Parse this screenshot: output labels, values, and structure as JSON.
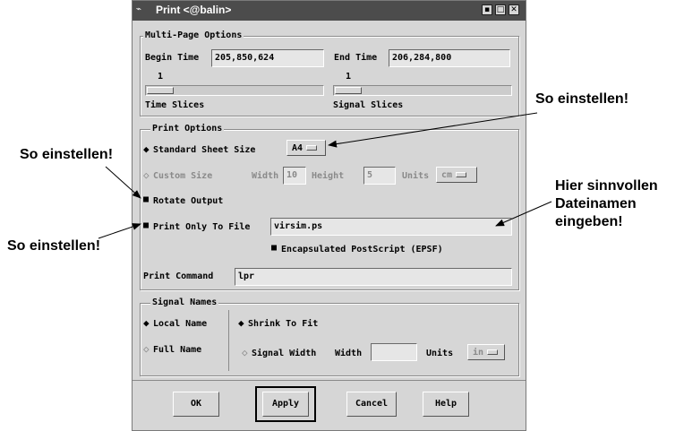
{
  "window": {
    "title": "Print <@balin>"
  },
  "multi_page": {
    "legend": "Multi-Page Options",
    "begin_time_label": "Begin Time",
    "begin_time_value": "205,850,624",
    "end_time_label": "End Time",
    "end_time_value": "206,284,800",
    "time_slices_count": "1",
    "signal_slices_count": "1",
    "time_slices_label": "Time Slices",
    "signal_slices_label": "Signal Slices"
  },
  "print_options": {
    "legend": "Print Options",
    "standard_sheet_label": "Standard Sheet Size",
    "sheet_size": "A4",
    "custom_size_label": "Custom Size",
    "width_label": "Width",
    "width_value": "10",
    "height_label": "Height",
    "height_value": "5",
    "units_label": "Units",
    "units_value": "cm",
    "rotate_label": "Rotate Output",
    "print_to_file_label": "Print Only To File",
    "file_value": "virsim.ps",
    "epsf_label": "Encapsulated PostScript (EPSF)"
  },
  "print_command": {
    "label": "Print Command",
    "value": "lpr"
  },
  "signal_names": {
    "legend": "Signal Names",
    "local_name": "Local Name",
    "full_name": "Full Name",
    "shrink_to_fit": "Shrink To Fit",
    "signal_width": "Signal Width",
    "width_label": "Width",
    "units_label": "Units",
    "units_value": "in"
  },
  "buttons": {
    "ok": "OK",
    "apply": "Apply",
    "cancel": "Cancel",
    "help": "Help"
  },
  "annotations": {
    "top_right": "So einstellen!",
    "left_upper": "So einstellen!",
    "left_lower": "So einstellen!",
    "right_line1": "Hier sinnvollen",
    "right_line2": "Dateinamen",
    "right_line3": "eingeben!"
  },
  "colors": {
    "titlebar": "#4c4c4c",
    "dialog": "#d6d6d6"
  }
}
